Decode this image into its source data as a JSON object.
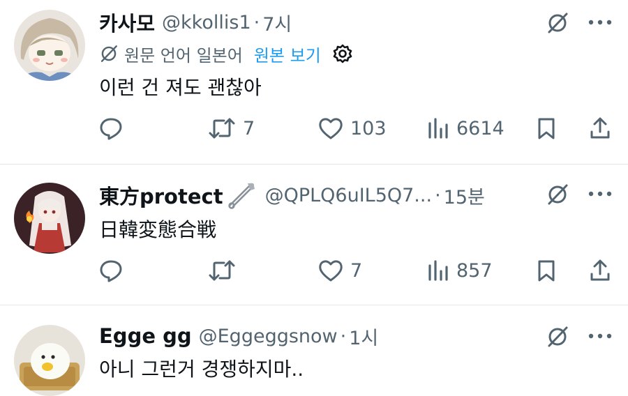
{
  "tweets": [
    {
      "name": "카사모",
      "handle": "@kkollis1",
      "dot": "·",
      "time": "7시",
      "translation": {
        "label": "원문 언어 일본어",
        "link": "원본 보기"
      },
      "text": "이런 건 져도 괜찮아",
      "replies": "",
      "retweets": "7",
      "likes": "103",
      "views": "6614"
    },
    {
      "name": "東方protect",
      "handle": "@QPLQ6uIL5Q7...",
      "dot": "·",
      "time": "15분",
      "text": "日韓変態合戦",
      "replies": "",
      "retweets": "",
      "likes": "7",
      "views": "857"
    },
    {
      "name": "Egge gg",
      "handle": "@Eggeggsnow",
      "dot": "·",
      "time": "1시",
      "text": "아니 그런거 경쟁하지마.."
    }
  ],
  "icons": {
    "grok": "grok-icon",
    "more": "more-icon",
    "reply": "reply-icon",
    "retweet": "retweet-icon",
    "like": "like-icon",
    "views": "views-icon",
    "bookmark": "bookmark-icon",
    "share": "share-icon",
    "pin": "safety-pin-emoji",
    "gear": "gear-icon"
  },
  "colors": {
    "text": "#0f1419",
    "muted": "#536471",
    "link": "#1d9bf0",
    "divider": "#e6e9ec"
  }
}
